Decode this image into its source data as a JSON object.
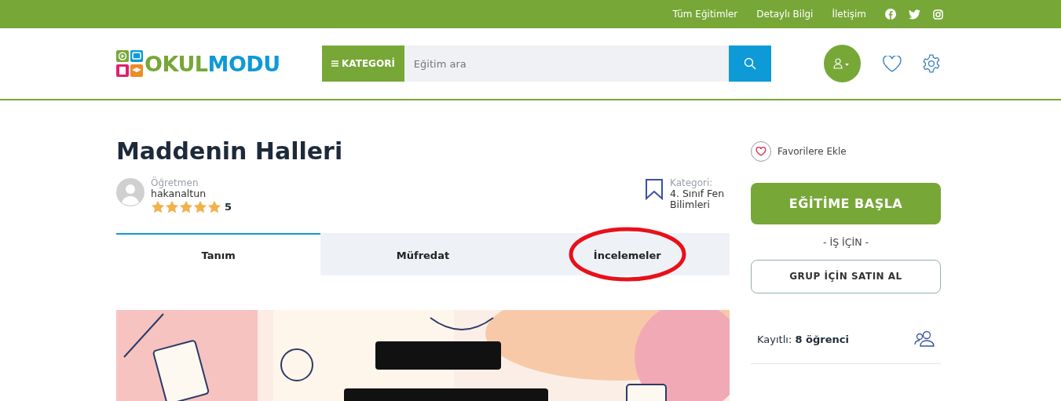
{
  "top_links": [
    "Tüm Eğitimler",
    "Detaylı Bilgi",
    "İletişim"
  ],
  "logo": {
    "part_1": "OKUL",
    "part_2": "MODU"
  },
  "category_button": "KATEGORİ",
  "search": {
    "placeholder": "Eğitim ara"
  },
  "course": {
    "title": "Maddenin Halleri",
    "teacher_label": "Öğretmen",
    "teacher": "hakanaltun",
    "stars": 5,
    "rating": "5",
    "category_label": "Kategori:",
    "category": "4. Sınıf Fen Bilimleri"
  },
  "tabs": [
    {
      "label": "Tanım",
      "selected": true,
      "circled": false
    },
    {
      "label": "Müfredat",
      "selected": false,
      "circled": false
    },
    {
      "label": "İncelemeler",
      "selected": false,
      "circled": true
    }
  ],
  "sidebar": {
    "favorite": "Favorilere Ekle",
    "start_button": "EĞİTİME BAŞLA",
    "business_label": "- İŞ İÇİN -",
    "group_button": "GRUP İÇİN SATIN AL",
    "info": [
      {
        "text": "Kayıtlı: **8 öğrenci**"
      }
    ]
  }
}
